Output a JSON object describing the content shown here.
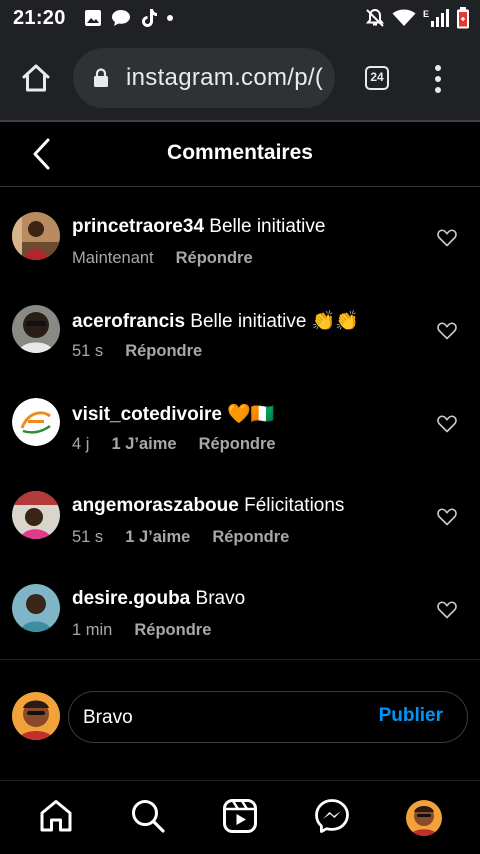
{
  "status_bar": {
    "time": "21:20",
    "network_label": "E",
    "icons": [
      "gallery-icon",
      "chat-bubble-icon",
      "tiktok-icon",
      "notification-dot",
      "mute-bell-icon",
      "wifi-icon",
      "signal-icon",
      "battery-low-icon"
    ]
  },
  "browser": {
    "url": "instagram.com/p/(",
    "tab_count": "24",
    "icons": [
      "home-icon",
      "lock-icon",
      "tabs-icon",
      "more-vertical-icon"
    ]
  },
  "header": {
    "title": "Commentaires",
    "back_icon": "chevron-left-icon"
  },
  "comments": [
    {
      "username": "princetraore34",
      "text": " Belle initiative",
      "time": "Maintenant",
      "likes": "",
      "reply_label": "Répondre"
    },
    {
      "username": "acerofrancis",
      "text": " Belle initiative 👏👏",
      "time": "51 s",
      "likes": "",
      "reply_label": "Répondre"
    },
    {
      "username": "visit_cotedivoire",
      "text": " 🧡🇨🇮",
      "time": "4 j",
      "likes": "1 J’aime",
      "reply_label": "Répondre"
    },
    {
      "username": "angemoraszaboue",
      "text": " Félicitations",
      "time": "51 s",
      "likes": "1 J’aime",
      "reply_label": "Répondre"
    },
    {
      "username": "desire.gouba",
      "text": " Bravo",
      "time": "1 min",
      "likes": "",
      "reply_label": "Répondre"
    }
  ],
  "composer": {
    "value": "Bravo",
    "publish_label": "Publier"
  },
  "bottom_nav": {
    "items": [
      "home-icon",
      "search-icon",
      "reels-icon",
      "messenger-icon",
      "profile-avatar"
    ]
  },
  "colors": {
    "background": "#000000",
    "browser_chrome": "#202124",
    "link_blue": "#0095f6",
    "muted_text": "#a8a8a8"
  }
}
